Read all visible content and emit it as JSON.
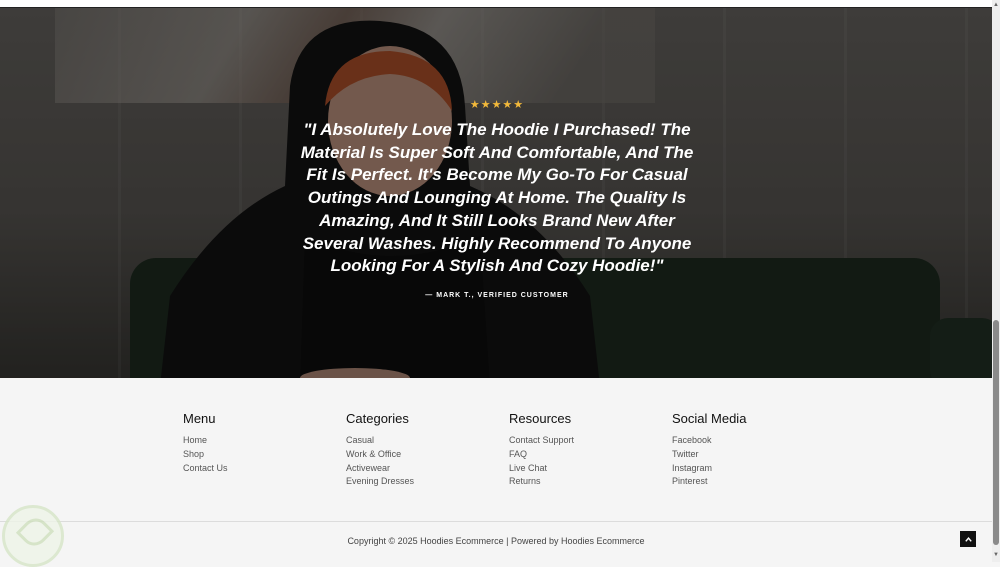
{
  "testimonial": {
    "stars": "★★★★★",
    "quote": "\"I Absolutely Love The Hoodie I Purchased! The Material Is Super Soft And Comfortable, And The Fit Is Perfect. It's Become My Go-To For Casual Outings And Lounging At Home. The Quality Is Amazing, And It Still Looks Brand New After Several Washes. Highly Recommend To Anyone Looking For A Stylish And Cozy Hoodie!\"",
    "author": "— Mark T., Verified Customer"
  },
  "footer": {
    "columns": [
      {
        "title": "Menu",
        "links": [
          "Home",
          "Shop",
          "Contact Us"
        ]
      },
      {
        "title": "Categories",
        "links": [
          "Casual",
          "Work & Office",
          "Activewear",
          "Evening Dresses"
        ]
      },
      {
        "title": "Resources",
        "links": [
          "Contact Support",
          "FAQ",
          "Live Chat",
          "Returns"
        ]
      },
      {
        "title": "Social Media",
        "links": [
          "Facebook",
          "Twitter",
          "Instagram",
          "Pinterest"
        ]
      }
    ],
    "copyright": "Copyright © 2025 Hoodies Ecommerce | Powered by Hoodies Ecommerce",
    "scroll_top_icon": "chevron-up-icon"
  },
  "colors": {
    "star": "#f2b93b",
    "footer_bg": "#f5f5f5"
  }
}
